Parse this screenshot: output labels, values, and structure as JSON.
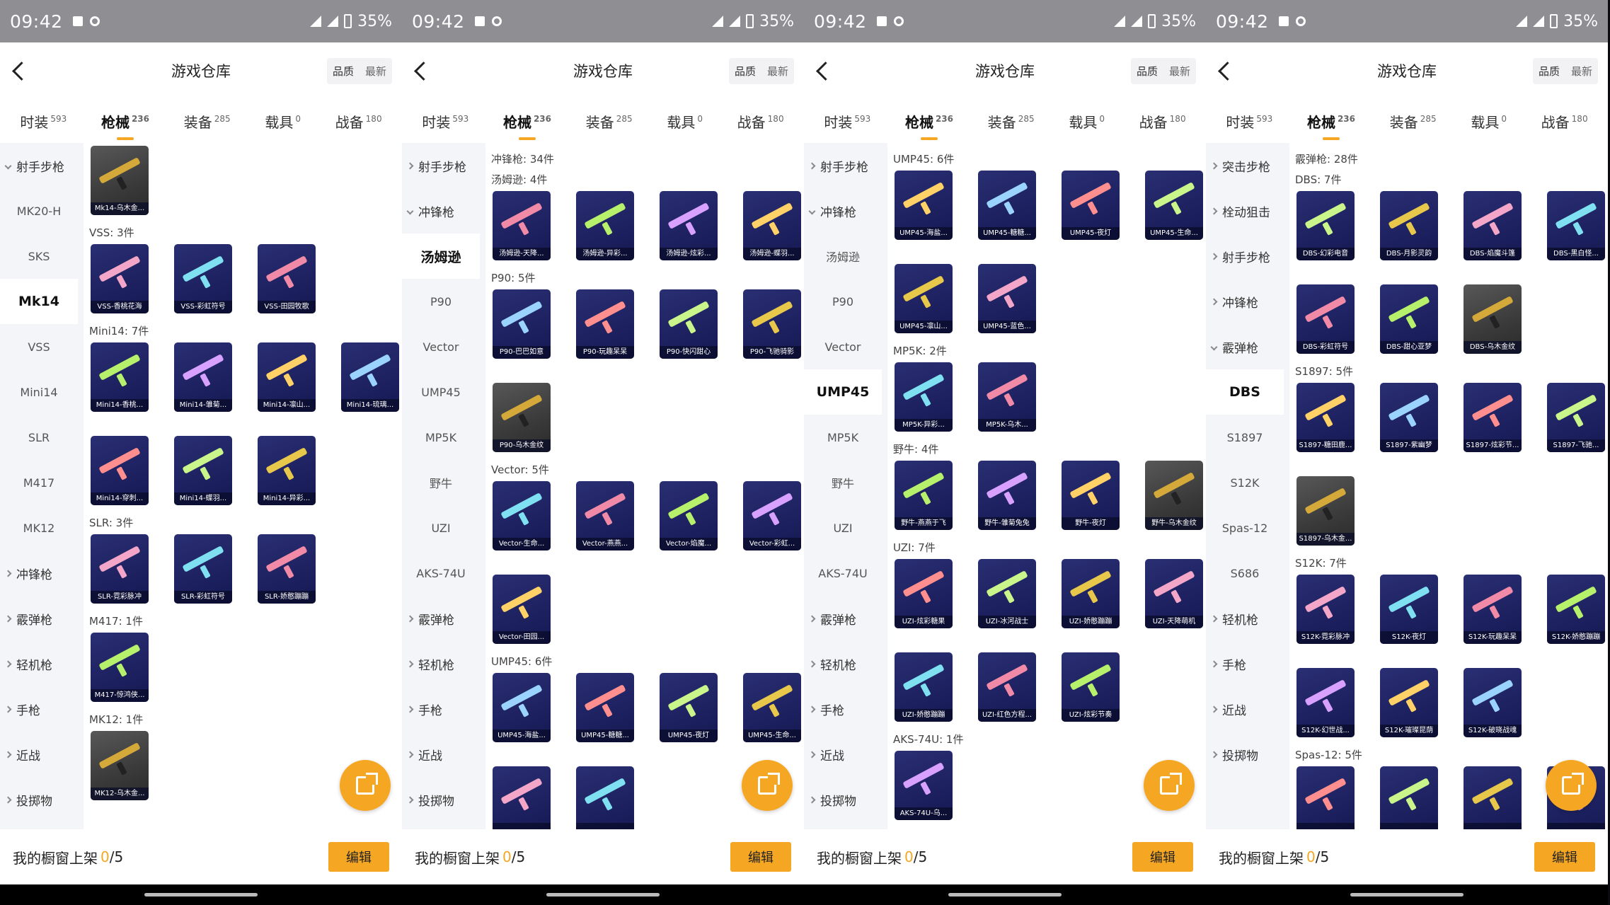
{
  "status_bar": {
    "time": "09:42",
    "battery": "35%"
  },
  "header": {
    "title": "游戏仓库",
    "sort_quality": "品质",
    "sort_newest": "最新"
  },
  "tabs": [
    {
      "label": "时装",
      "count": "593"
    },
    {
      "label": "枪械",
      "count": "236"
    },
    {
      "label": "装备",
      "count": "285"
    },
    {
      "label": "载具",
      "count": "0"
    },
    {
      "label": "战备",
      "count": "180"
    }
  ],
  "footer": {
    "label": "我的橱窗上架",
    "count": "0",
    "total": "/5",
    "edit": "编辑"
  },
  "panels": [
    {
      "sidebar": [
        {
          "label": "射手步枪",
          "type": "cat",
          "open": true
        },
        {
          "label": "MK20-H"
        },
        {
          "label": "SKS"
        },
        {
          "label": "Mk14",
          "selected": true
        },
        {
          "label": "VSS"
        },
        {
          "label": "Mini14"
        },
        {
          "label": "SLR"
        },
        {
          "label": "M417"
        },
        {
          "label": "MK12"
        },
        {
          "label": "冲锋枪",
          "type": "cat"
        },
        {
          "label": "霰弹枪",
          "type": "cat"
        },
        {
          "label": "轻机枪",
          "type": "cat"
        },
        {
          "label": "手枪",
          "type": "cat"
        },
        {
          "label": "近战",
          "type": "cat"
        },
        {
          "label": "投掷物",
          "type": "cat"
        }
      ],
      "sections": [
        {
          "title": "",
          "items": [
            "Mk14-乌木金..."
          ]
        },
        {
          "title": "VSS: 3件",
          "items": [
            "VSS-香桃花海",
            "VSS-彩虹符号",
            "VSS-田园牧歌"
          ]
        },
        {
          "title": "Mini14: 7件",
          "items": [
            "Mini14-香桃...",
            "Mini14-雏菊...",
            "Mini14-凛山...",
            "Mini14-琉璃...",
            "Mini14-穿刺...",
            "Mini14-蝶羽...",
            "Mini14-异彩..."
          ]
        },
        {
          "title": "SLR: 3件",
          "items": [
            "SLR-霓彩脉冲",
            "SLR-彩虹符号",
            "SLR-娇憨蹦蹦"
          ]
        },
        {
          "title": "M417: 1件",
          "items": [
            "M417-惊鸿侠..."
          ]
        },
        {
          "title": "MK12: 1件",
          "items": [
            "MK12-乌木金..."
          ]
        }
      ]
    },
    {
      "sidebar": [
        {
          "label": "射手步枪",
          "type": "cat"
        },
        {
          "label": "冲锋枪",
          "type": "cat",
          "open": true
        },
        {
          "label": "汤姆逊",
          "selected": true
        },
        {
          "label": "P90"
        },
        {
          "label": "Vector"
        },
        {
          "label": "UMP45"
        },
        {
          "label": "MP5K"
        },
        {
          "label": "野牛"
        },
        {
          "label": "UZI"
        },
        {
          "label": "AKS-74U"
        },
        {
          "label": "霰弹枪",
          "type": "cat"
        },
        {
          "label": "轻机枪",
          "type": "cat"
        },
        {
          "label": "手枪",
          "type": "cat"
        },
        {
          "label": "近战",
          "type": "cat"
        },
        {
          "label": "投掷物",
          "type": "cat"
        }
      ],
      "sections": [
        {
          "title": "冲锋枪: 34件",
          "items": []
        },
        {
          "title": "汤姆逊: 4件",
          "items": [
            "汤姆逊-天降...",
            "汤姆逊-异彩...",
            "汤姆逊-炫彩...",
            "汤姆逊-蝶羽..."
          ]
        },
        {
          "title": "P90: 5件",
          "items": [
            "P90-巴巴如意",
            "P90-玩趣呆呆",
            "P90-快闪甜心",
            "P90-飞驰骑影",
            "P90-乌木金纹"
          ]
        },
        {
          "title": "Vector: 5件",
          "items": [
            "Vector-生命...",
            "Vector-燕燕...",
            "Vector-焰魔...",
            "Vector-彩虹...",
            "Vector-田园..."
          ]
        },
        {
          "title": "UMP45: 6件",
          "items": [
            "UMP45-海盐...",
            "UMP45-糖糖...",
            "UMP45-夜灯",
            "UMP45-生命...",
            "",
            ""
          ]
        }
      ]
    },
    {
      "sidebar": [
        {
          "label": "射手步枪",
          "type": "cat"
        },
        {
          "label": "冲锋枪",
          "type": "cat",
          "open": true
        },
        {
          "label": "汤姆逊"
        },
        {
          "label": "P90"
        },
        {
          "label": "Vector"
        },
        {
          "label": "UMP45",
          "selected": true
        },
        {
          "label": "MP5K"
        },
        {
          "label": "野牛"
        },
        {
          "label": "UZI"
        },
        {
          "label": "AKS-74U"
        },
        {
          "label": "霰弹枪",
          "type": "cat"
        },
        {
          "label": "轻机枪",
          "type": "cat"
        },
        {
          "label": "手枪",
          "type": "cat"
        },
        {
          "label": "近战",
          "type": "cat"
        },
        {
          "label": "投掷物",
          "type": "cat"
        }
      ],
      "sections": [
        {
          "title": "UMP45: 6件",
          "items": [
            "UMP45-海盐...",
            "UMP45-糖糖...",
            "UMP45-夜灯",
            "UMP45-生命...",
            "UMP45-凛山...",
            "UMP45-蓝色..."
          ]
        },
        {
          "title": "MP5K: 2件",
          "items": [
            "MP5K-异彩...",
            "MP5K-乌木..."
          ]
        },
        {
          "title": "野牛: 4件",
          "items": [
            "野牛-燕燕于飞",
            "野牛-雏菊兔兔",
            "野牛-夜灯",
            "野牛-乌木金纹"
          ]
        },
        {
          "title": "UZI: 7件",
          "items": [
            "UZI-炫彩糖果",
            "UZI-冰河战士",
            "UZI-娇憨蹦蹦",
            "UZI-天降萌机",
            "UZI-娇憨蹦蹦",
            "UZI-红色方程...",
            "UZI-炫彩节奏"
          ]
        },
        {
          "title": "AKS-74U: 1件",
          "items": [
            "AKS-74U-乌..."
          ]
        }
      ]
    },
    {
      "sidebar": [
        {
          "label": "突击步枪",
          "type": "cat"
        },
        {
          "label": "栓动狙击",
          "type": "cat"
        },
        {
          "label": "射手步枪",
          "type": "cat"
        },
        {
          "label": "冲锋枪",
          "type": "cat"
        },
        {
          "label": "霰弹枪",
          "type": "cat",
          "open": true
        },
        {
          "label": "DBS",
          "selected": true
        },
        {
          "label": "S1897"
        },
        {
          "label": "S12K"
        },
        {
          "label": "Spas-12"
        },
        {
          "label": "S686"
        },
        {
          "label": "轻机枪",
          "type": "cat"
        },
        {
          "label": "手枪",
          "type": "cat"
        },
        {
          "label": "近战",
          "type": "cat"
        },
        {
          "label": "投掷物",
          "type": "cat"
        }
      ],
      "sections": [
        {
          "title": "霰弹枪: 28件",
          "items": []
        },
        {
          "title": "DBS: 7件",
          "items": [
            "DBS-幻彩电音",
            "DBS-月影灵韵",
            "DBS-焰魔斗篷",
            "DBS-黑白怪...",
            "DBS-彩虹符号",
            "DBS-甜心亚梦",
            "DBS-乌木金纹"
          ]
        },
        {
          "title": "S1897: 5件",
          "items": [
            "S1897-糖田鹿...",
            "S1897-紫幽梦",
            "S1897-炫彩节...",
            "S1897-飞驰...",
            "S1897-乌木金..."
          ]
        },
        {
          "title": "S12K: 7件",
          "items": [
            "S12K-霓彩脉冲",
            "S12K-夜灯",
            "S12K-玩趣呆呆",
            "S12K-娇憨蹦蹦",
            "S12K-幻世战...",
            "S12K-璀璨昆荫",
            "S12K-破晓战魂"
          ]
        },
        {
          "title": "Spas-12: 5件",
          "items": [
            "",
            "",
            "",
            ""
          ]
        }
      ]
    }
  ],
  "colors": {
    "accent": "#f5a623",
    "tile": "#1d2160",
    "tile_gold": "#3a3a3a"
  },
  "icons": {
    "back": "chevron-left-icon",
    "share": "share-export-icon"
  }
}
